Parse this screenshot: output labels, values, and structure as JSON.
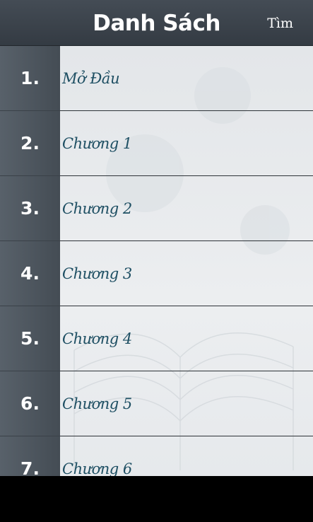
{
  "header": {
    "title": "Danh Sách",
    "search_label": "Tìm"
  },
  "chapters": [
    {
      "number": "1.",
      "label": "Mở Đầu"
    },
    {
      "number": "2.",
      "label": "Chương 1"
    },
    {
      "number": "3.",
      "label": "Chương 2"
    },
    {
      "number": "4.",
      "label": "Chương 3"
    },
    {
      "number": "5.",
      "label": "Chương 4"
    },
    {
      "number": "6.",
      "label": "Chương 5"
    },
    {
      "number": "7.",
      "label": "Chương 6"
    }
  ],
  "colors": {
    "header_bg": "#3b424a",
    "number_column_bg": "#4d555d",
    "label_text": "#1e4f63",
    "list_bg": "#e8eaed"
  }
}
